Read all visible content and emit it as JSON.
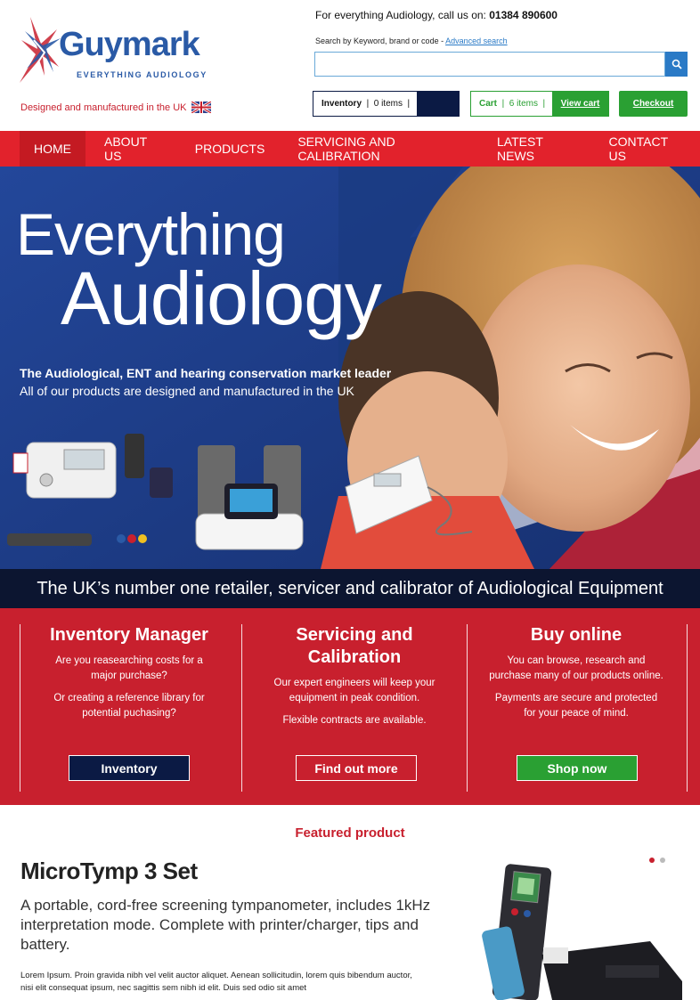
{
  "brand": {
    "name_part1": "Guy",
    "name_part2": "mark",
    "tagline": "EVERYTHING AUDIOLOGY",
    "made_in": "Designed and manufactured in the UK"
  },
  "header": {
    "phone_prefix": "For everything Audiology, call us on:",
    "phone_number": "01384 890600",
    "search_label": "Search by Keyword, brand or code -",
    "advanced_search": "Advanced search",
    "search_placeholder": "",
    "inventory_label": "Inventory",
    "inventory_count": "0 items",
    "cart_label": "Cart",
    "cart_count": "6 items",
    "view_cart": "View cart",
    "checkout": "Checkout"
  },
  "nav": {
    "items": [
      {
        "label": "HOME"
      },
      {
        "label": "ABOUT US"
      },
      {
        "label": "PRODUCTS"
      },
      {
        "label": "SERVICING AND CALIBRATION"
      },
      {
        "label": "LATEST NEWS"
      },
      {
        "label": "CONTACT US"
      }
    ]
  },
  "hero": {
    "line1": "Everything",
    "line2": "Audiology",
    "sub_bold": "The Audiological, ENT and hearing conservation market leader",
    "sub": "All of our products are designed and manufactured in the UK",
    "band": "The UK’s number one retailer, servicer and calibrator of Audiological Equipment"
  },
  "promo": {
    "inventory": {
      "title": "Inventory Manager",
      "p1": "Are you reasearching costs for a major purchase?",
      "p2": "Or creating a reference library for potential puchasing?",
      "button": "Inventory"
    },
    "servicing": {
      "title_line1": "Servicing and",
      "title_line2": "Calibration",
      "p1": "Our expert engineers will keep your equipment in peak condition.",
      "p2": "Flexible contracts are available.",
      "button": "Find out more"
    },
    "buy": {
      "title": "Buy online",
      "p1": "You can browse, research and purchase many of our products online.",
      "p2": "Payments are secure and protected for your peace of mind.",
      "button": "Shop now"
    }
  },
  "featured": {
    "label": "Featured product",
    "title": "MicroTymp 3 Set",
    "description": "A portable, cord-free screening tympanometer, includes 1kHz interpretation mode. Complete with printer/charger, tips and battery.",
    "lorem": "Lorem Ipsum. Proin gravida nibh vel velit auctor aliquet. Aenean sollicitudin, lorem quis bibendum auctor, nisi elit consequat ipsum, nec sagittis sem nibh id elit. Duis sed odio sit amet"
  },
  "colors": {
    "brand_red": "#e2222c",
    "promo_red": "#c8202e",
    "navy": "#0b1a44",
    "green": "#2aa033",
    "blue": "#2a7ac6"
  }
}
